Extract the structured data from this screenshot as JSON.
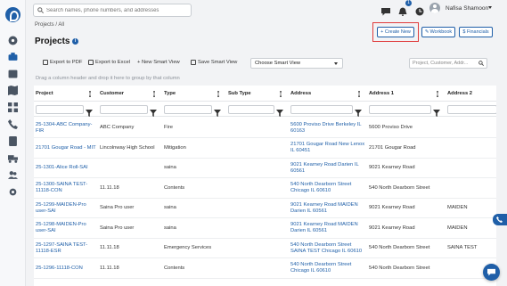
{
  "topbar": {
    "search_placeholder": "Search names, phone numbers, and addresses",
    "notification_count": "1",
    "user_name": "Nafisa Shamoon"
  },
  "breadcrumb": "Projects / All",
  "page_title": "Projects",
  "header_buttons": {
    "create_new": "+ Create New",
    "workbook": "Workbook",
    "financials": "$ Financials"
  },
  "toolbar": {
    "export_pdf": "Export to PDF",
    "export_excel": "Export to Excel",
    "new_smart_view": "+ New Smart View",
    "save_smart_view": "Save Smart View",
    "smart_view_select": "Choose Smart View",
    "grid_search_placeholder": "Project, Customer, Addr..."
  },
  "group_hint": "Drag a column header and drop it here to group by that column",
  "columns": [
    "Project",
    "Customer",
    "Type",
    "Sub Type",
    "Address",
    "Address 1",
    "Address 2"
  ],
  "rows": [
    {
      "project": "25-1304-ABC Company-FIR",
      "customer": "ABC Company",
      "type": "Fire",
      "subtype": "",
      "address": "5600 Proviso Drive Berkeley IL 60163",
      "address1": "5600 Proviso Drive",
      "address2": ""
    },
    {
      "project": "21701 Gougar Road - MIT",
      "customer": "Lincolnway High School",
      "type": "Mitigation",
      "subtype": "",
      "address": "21701 Gougar Road New Lenox IL 60451",
      "address1": "21701 Gougar Road",
      "address2": ""
    },
    {
      "project": "25-1301-Alice Roll-SAI",
      "customer": "",
      "type": "saina",
      "subtype": "",
      "address": "9021 Kearney Road Darien IL 60561",
      "address1": "9021 Kearney Road",
      "address2": ""
    },
    {
      "project": "25-1300-SAINA TEST-11118-CON",
      "customer": "11.11.18",
      "type": "Contents",
      "subtype": "",
      "address": "540 North Dearborn Street Chicago IL 60610",
      "address1": "540 North Dearborn Street",
      "address2": ""
    },
    {
      "project": "25-1299-MAIDEN-Pro user-SAI",
      "customer": "Saina Pro user",
      "type": "saina",
      "subtype": "",
      "address": "9021 Kearney Road MAIDEN Darien IL 60561",
      "address1": "9021 Kearney Road",
      "address2": "MAIDEN"
    },
    {
      "project": "25-1298-MAIDEN-Pro user-SAI",
      "customer": "Saina Pro user",
      "type": "saina",
      "subtype": "",
      "address": "9021 Kearney Road MAIDEN Darien IL 60561",
      "address1": "9021 Kearney Road",
      "address2": "MAIDEN"
    },
    {
      "project": "25-1297-SAINA TEST-11118-ESR",
      "customer": "11.11.18",
      "type": "Emergency Services",
      "subtype": "",
      "address": "540 North Dearborn Street SAINA TEST Chicago IL 60610",
      "address1": "540 North Dearborn Street",
      "address2": "SAINA TEST"
    },
    {
      "project": "25-1296-11118-CON",
      "customer": "11.11.18",
      "type": "Contents",
      "subtype": "",
      "address": "540 North Dearborn Street Chicago IL 60610",
      "address1": "540 North Dearborn Street",
      "address2": ""
    }
  ],
  "colors": {
    "accent": "#1f5fa8",
    "highlight": "#e03b3b"
  }
}
